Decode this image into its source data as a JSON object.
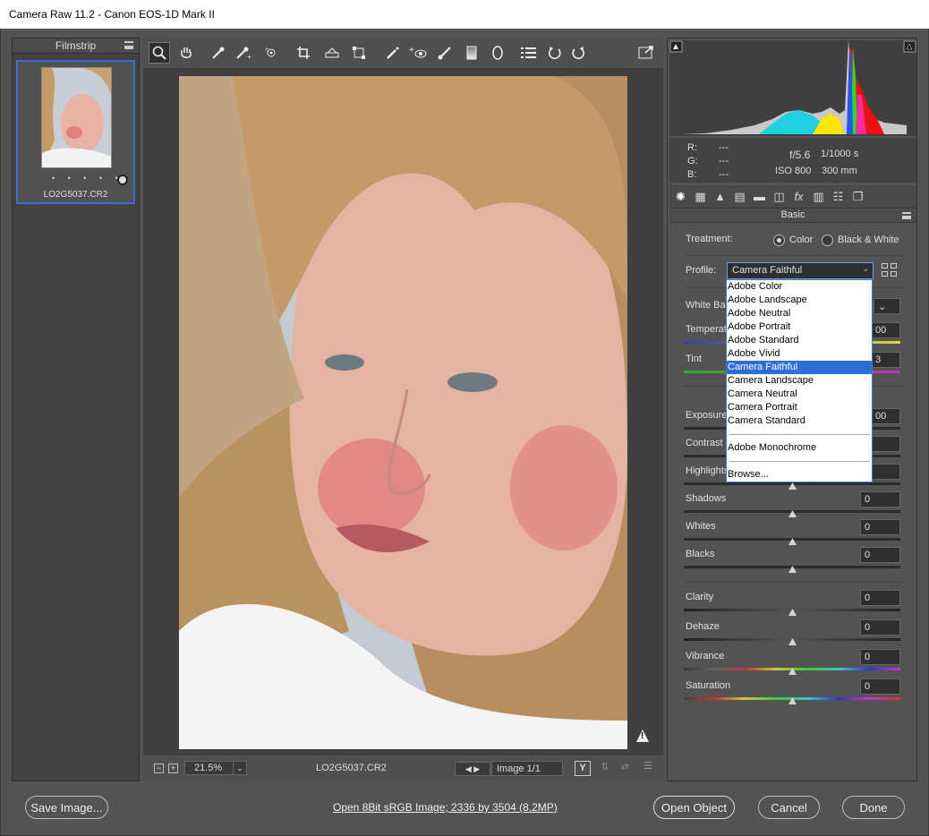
{
  "window": {
    "title": "Camera Raw 11.2  -  Canon EOS-1D Mark II"
  },
  "filmstrip": {
    "title": "Filmstrip",
    "items": [
      {
        "name": "LO2G5037.CR2",
        "rating": "• • • • •"
      }
    ]
  },
  "toolbar": {
    "tools": [
      "zoom-tool-icon",
      "hand-tool-icon",
      "white-balance-icon",
      "color-sampler-icon",
      "targeted-adjustment-icon",
      "crop-icon",
      "straighten-icon",
      "transform-icon",
      "spot-removal-icon",
      "red-eye-icon",
      "adjustment-brush-icon",
      "graduated-filter-icon",
      "radial-filter-icon",
      "preferences-icon",
      "rotate-left-icon",
      "rotate-right-icon",
      "fullscreen-icon"
    ]
  },
  "preview": {
    "warning": "!"
  },
  "bottom": {
    "zoom": "21.5%",
    "filename": "LO2G5037.CR2",
    "image_counter": "Image 1/1",
    "y_label": "Y"
  },
  "info": {
    "r": "R:",
    "g": "G:",
    "b": "B:",
    "r_val": "---",
    "g_val": "---",
    "b_val": "---",
    "aperture": "f/5.6",
    "shutter": "1/1000 s",
    "iso": "ISO 800",
    "focal": "300 mm"
  },
  "basic": {
    "title": "Basic",
    "treatment_label": "Treatment:",
    "color_label": "Color",
    "bw_label": "Black & White",
    "profile_label": "Profile:",
    "profile_value": "Camera Faithful",
    "white_balance_label": "White Bal",
    "temperature_label": "Temperat",
    "temperature_value": "00",
    "tint_label": "Tint",
    "tint_value": "3",
    "exposure_label": "Exposure",
    "exposure_value": "00",
    "contrast_label": "Contrast",
    "highlights_label": "Highlights",
    "shadows_label": "Shadows",
    "shadows_value": "0",
    "whites_label": "Whites",
    "whites_value": "0",
    "blacks_label": "Blacks",
    "blacks_value": "0",
    "clarity_label": "Clarity",
    "clarity_value": "0",
    "dehaze_label": "Dehaze",
    "dehaze_value": "0",
    "vibrance_label": "Vibrance",
    "vibrance_value": "0",
    "saturation_label": "Saturation",
    "saturation_value": "0"
  },
  "profile_menu": {
    "items": [
      "Adobe Color",
      "Adobe Landscape",
      "Adobe Neutral",
      "Adobe Portrait",
      "Adobe Standard",
      "Adobe Vivid",
      "Camera Faithful",
      "Camera Landscape",
      "Camera Neutral",
      "Camera Portrait",
      "Camera Standard"
    ],
    "selected": "Camera Faithful",
    "mono": "Adobe Monochrome",
    "browse": "Browse..."
  },
  "footer": {
    "save": "Save Image...",
    "info_link": "Open 8Bit sRGB Image; 2336 by 3504 (8.2MP)",
    "open": "Open Object",
    "cancel": "Cancel",
    "done": "Done"
  },
  "colors": {
    "accent": "#2b6fd6",
    "panel": "#535353",
    "dark": "#3f3f3f"
  }
}
